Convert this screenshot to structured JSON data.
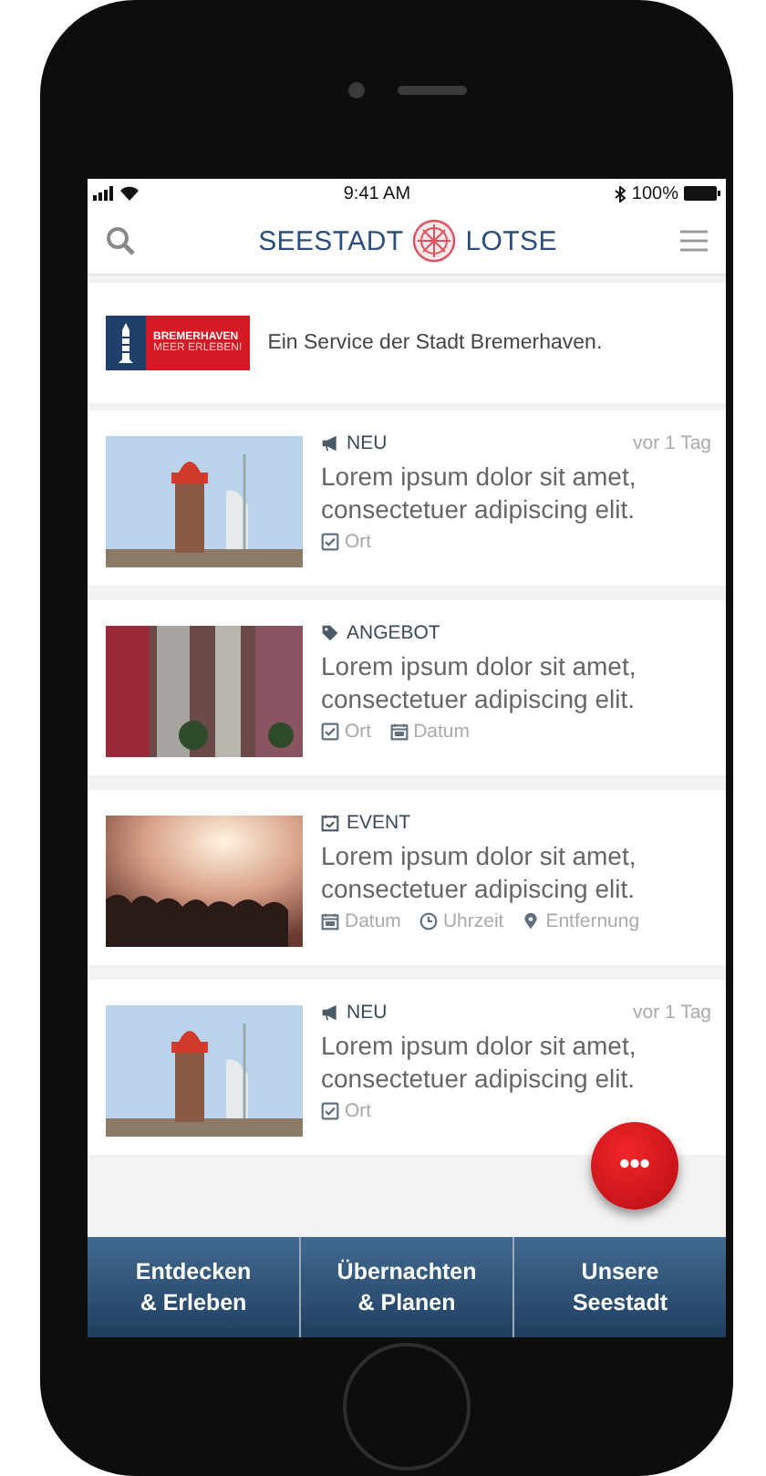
{
  "status_bar": {
    "time": "9:41 AM",
    "battery": "100%"
  },
  "header": {
    "logo_left": "SEESTADT",
    "logo_right": "LOTSE"
  },
  "banner": {
    "logo_line_1": "BREMERHAVEN",
    "logo_line_2": "MEER ERLEBEN!",
    "text": "Ein Service der Stadt Bremerhaven."
  },
  "items": [
    {
      "kind": "news",
      "tag": "NEU",
      "time": "vor 1 Tag",
      "title": "Lorem ipsum dolor sit amet, consectetuer adipiscing elit.",
      "meta": [
        {
          "kind": "place",
          "label": "Ort"
        }
      ]
    },
    {
      "kind": "offer",
      "tag": "ANGEBOT",
      "title": "Lorem ipsum dolor sit amet, consectetuer adipiscing elit.",
      "meta": [
        {
          "kind": "place",
          "label": "Ort"
        },
        {
          "kind": "date",
          "label": "Datum"
        }
      ]
    },
    {
      "kind": "event",
      "tag": "EVENT",
      "title": "Lorem ipsum dolor sit amet, consectetuer adipiscing elit.",
      "meta": [
        {
          "kind": "date",
          "label": "Datum"
        },
        {
          "kind": "time",
          "label": "Uhrzeit"
        },
        {
          "kind": "distance",
          "label": "Entfernung"
        }
      ]
    },
    {
      "kind": "news",
      "tag": "NEU",
      "time": "vor 1 Tag",
      "title": "Lorem ipsum dolor sit amet, consectetuer adipiscing elit.",
      "meta": [
        {
          "kind": "place",
          "label": "Ort"
        }
      ]
    }
  ],
  "fab": {
    "label": "•••"
  },
  "bottom_nav": [
    {
      "label": "Entdecken\n& Erleben"
    },
    {
      "label": "Übernachten\n& Planen"
    },
    {
      "label": "Unsere\nSeestadt"
    }
  ]
}
